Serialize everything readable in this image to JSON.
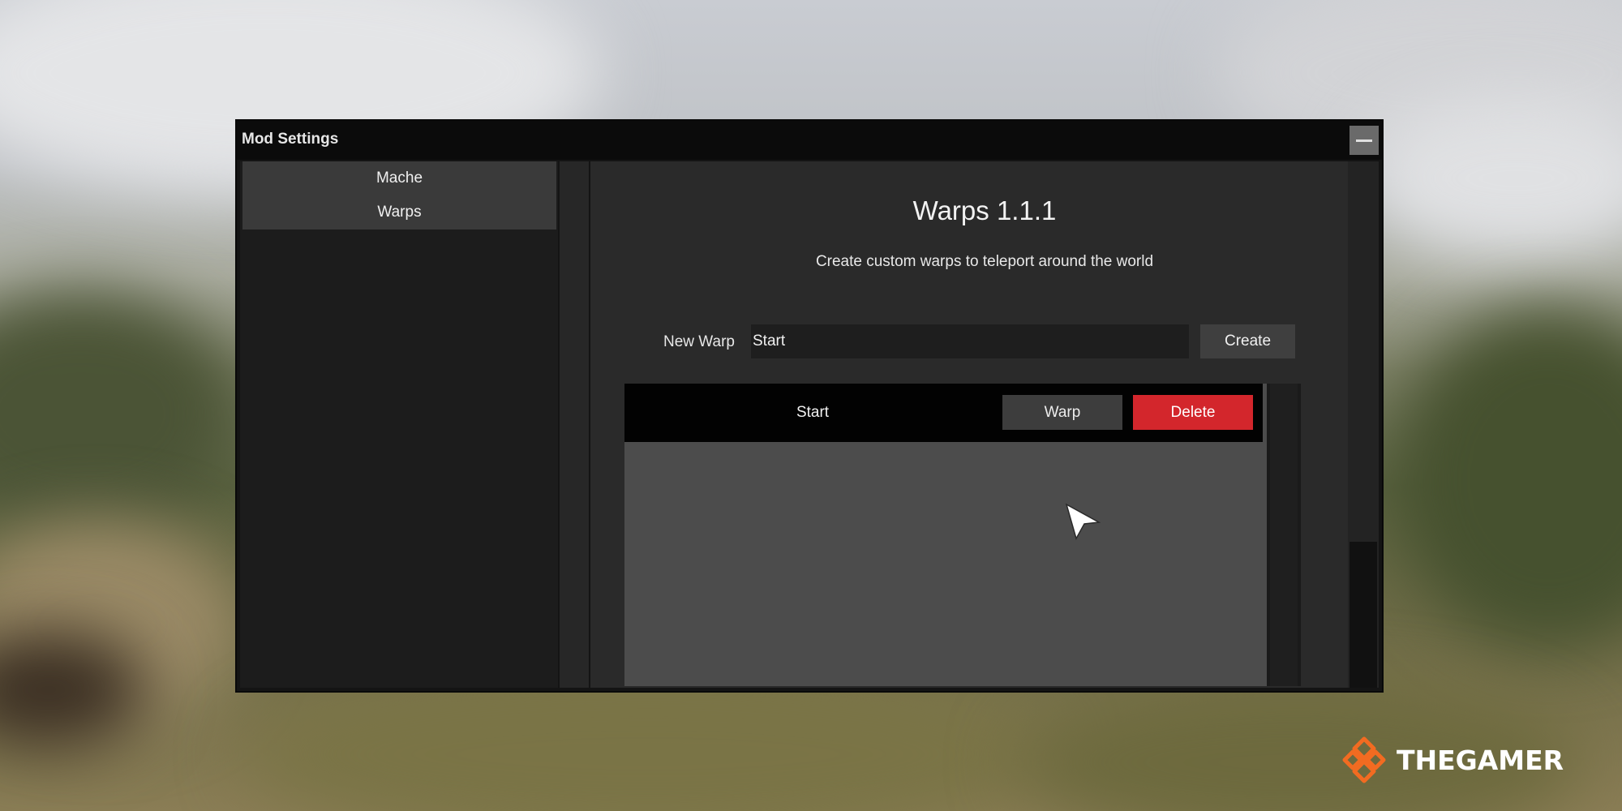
{
  "window": {
    "title": "Mod Settings",
    "minimize_icon": "minimize-icon"
  },
  "sidebar": {
    "items": [
      {
        "label": "Mache"
      },
      {
        "label": "Warps"
      }
    ]
  },
  "panel": {
    "title": "Warps 1.1.1",
    "description": "Create custom warps to teleport around the world",
    "new_warp_label": "New Warp",
    "new_warp_value": "Start",
    "create_label": "Create"
  },
  "warps": [
    {
      "name": "Start",
      "warp_label": "Warp",
      "delete_label": "Delete"
    }
  ],
  "colors": {
    "delete_red": "#d3262c",
    "logo_orange": "#f26b21"
  },
  "watermark": {
    "text": "THEGAMER",
    "icon": "thegamer-logo-icon"
  }
}
